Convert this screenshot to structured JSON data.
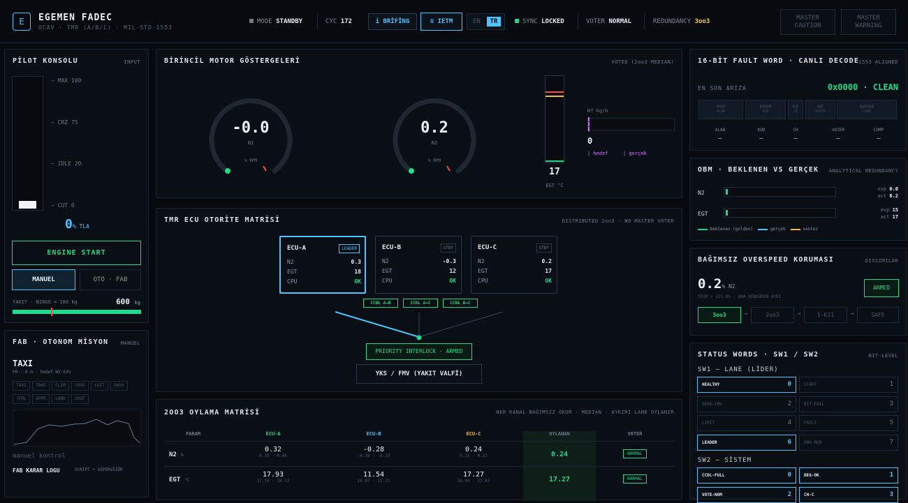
{
  "header": {
    "logo": "E",
    "title": "EGEMEN FADEC",
    "subtitle": "UCAV · TMR (A/B/C) · MIL-STD-1553",
    "mode_label": "MODE",
    "mode_value": "STANDBY",
    "cyc_label": "CYC",
    "cyc_value": "172",
    "briefing": "i BRİFİNG",
    "ietm": "≡ IETM",
    "lang_en": "EN",
    "lang_tr": "TR",
    "sync_label": "SYNC",
    "sync_value": "LOCKED",
    "voter_label": "VOTER",
    "voter_value": "NORMAL",
    "redundancy_label": "REDUNDANCY",
    "redundancy_value": "3oo3",
    "master_caution": [
      "MASTER",
      "CAUTION"
    ],
    "master_warning": [
      "MASTER",
      "WARNING"
    ]
  },
  "pilot": {
    "title": "PİLOT KONSOLU",
    "tag": "INPUT",
    "ticks": [
      "— MAX 100",
      "— CRZ 75",
      "— IDLE 20",
      "— CUT 0"
    ],
    "tla_value": "0",
    "tla_unit": "% TLA",
    "engine_start": "ENGINE START",
    "manual": "MANUEL",
    "auto": "OTO · FAB",
    "fuel_label": "YAKIT · BINGO = 180 kg",
    "fuel_value": "600",
    "fuel_unit": "kg",
    "fuel_fraction": 0.6
  },
  "fab": {
    "title": "FAB · OTONOM MİSYON",
    "tag": "MANUEL",
    "phase": "TAXI",
    "phase_sub": "P0 · 0 m · hedef N2 63%",
    "phases": [
      "TAXI",
      "TAKE",
      "CLIM",
      "CRUI",
      "LOIT",
      "DASH",
      "RTB",
      "APPR",
      "LAND",
      "SHUT"
    ],
    "manual_ctrl": "manuel kontrol",
    "log_title": "FAB KARAR LOGU",
    "log_tag": "SCRIPT + SÜPERVİZÖR"
  },
  "engine": {
    "title": "BİRİNCİL MOTOR GÖSTERGELERİ",
    "tag": "VOTED (2oo3 MEDIAN)",
    "n1_value": "-0.0",
    "n1_label": "N1",
    "n1_unit": "% RPM",
    "n2_value": "0.2",
    "n2_label": "N2",
    "n2_unit": "% RPM",
    "egt_value": "17",
    "egt_label": "EGT °C",
    "wf_label": "Wf kg/h",
    "wf_value": "0",
    "wf_legend_target": "| hedef",
    "wf_legend_actual": "| gerçek"
  },
  "tmr": {
    "title": "TMR ECU OTORİTE MATRİSİ",
    "tag": "DISTRIBUTED 2oo3 · NO MASTER VOTER",
    "ecus": [
      {
        "name": "ECU-A",
        "tag": "LEADER",
        "n2": "0.3",
        "egt": "18",
        "cpu": "OK"
      },
      {
        "name": "ECU-B",
        "tag": "STBY",
        "n2": "-0.3",
        "egt": "12",
        "cpu": "OK"
      },
      {
        "name": "ECU-C",
        "tag": "STBY",
        "n2": "0.2",
        "egt": "17",
        "cpu": "OK"
      }
    ],
    "row_labels": [
      "N2",
      "EGT",
      "CPU"
    ],
    "ccdl": [
      "CCDL A↔B",
      "CCDL A↔C",
      "CCDL B↔C"
    ],
    "interlock": "PRIORITY INTERLOCK · ARMED",
    "fmv": "YKS / FMV (YAKIT VALFİ)"
  },
  "vote": {
    "title": "2OO3 OYLAMA MATRİSİ",
    "tag": "HER KANAL BAĞIMSIZ OKUR · MEDIAN · AYKIRI LANE OYLANIR",
    "headers": [
      "PARAM",
      "ECU-A",
      "ECU-B",
      "ECU-C",
      "OYLANAN",
      "VOTER"
    ],
    "rows": [
      {
        "param": "N2",
        "unit": "%",
        "a": "0.32",
        "a_r": "0.19 · 0.46",
        "b": "-0.28",
        "b_r": "-0.36 · -0.19",
        "c": "0.24",
        "c_r": "0.15 · 0.33",
        "voted": "0.24",
        "voter": "NORMAL"
      },
      {
        "param": "EGT",
        "unit": "°C",
        "a": "17.93",
        "a_r": "17.74 · 18.12",
        "b": "11.54",
        "b_r": "10.87 · 12.21",
        "c": "17.27",
        "c_r": "16.90 · 17.63",
        "voted": "17.27",
        "voter": "NORMAL"
      }
    ]
  },
  "fault": {
    "title": "16-BİT FAULT WORD · CANLI DECODE",
    "tag": "1553 ALIGNED",
    "last_label": "EN SON ARIZA",
    "last_value": "0x0000 · CLEAN",
    "cells": [
      {
        "v": "000",
        "l": "ALAN"
      },
      {
        "v": "0000",
        "l": "KOD"
      },
      {
        "v": "00",
        "l": "CH"
      },
      {
        "v": "00",
        "l": "VOTER"
      },
      {
        "v": "00000",
        "l": "COMP"
      }
    ],
    "labels": [
      "ALAN",
      "KOD",
      "CH",
      "VOTER",
      "COMP"
    ],
    "dash": "–"
  },
  "obm": {
    "title": "OBM · BEKLENEN VS GERÇEK",
    "tag": "ANALYTICAL REDUNDANCY",
    "n2_label": "N2",
    "n2_exp": "0.0",
    "n2_act": "0.2",
    "egt_label": "EGT",
    "egt_exp": "15",
    "egt_act": "17",
    "exp_label": "exp",
    "act_label": "act",
    "legend": [
      "beklenen (golden)",
      "gerçek",
      "sentez"
    ]
  },
  "overspeed": {
    "title": "BAĞIMSIZ OVERSPEED KORUMASI",
    "tag": "DISSIMILAR",
    "value": "0.2",
    "unit": "% N2",
    "trip": "TRIP > 115.0% · ANA DÖNGÜDEN AYRI",
    "armed": "ARMED",
    "chain": [
      "3oo3",
      "2oo3",
      "1-K11",
      "SAFE"
    ]
  },
  "status": {
    "title": "STATUS WORDS · SW1 / SW2",
    "tag": "BIT-LEVEL",
    "sw1_label": "SW1 — LANE (LİDER)",
    "sw2_label": "SW2 — SİSTEM",
    "sw1": [
      {
        "l": "HEALTHY",
        "n": "0",
        "on": true
      },
      {
        "l": "START",
        "n": "1",
        "on": false
      },
      {
        "l": "SENS-INV",
        "n": "2",
        "on": false
      },
      {
        "l": "BIT-FAIL",
        "n": "3",
        "on": false
      },
      {
        "l": "LIMIT",
        "n": "4",
        "on": false
      },
      {
        "l": "FAULT",
        "n": "5",
        "on": false
      },
      {
        "l": "LEADER",
        "n": "6",
        "on": true
      },
      {
        "l": "ENG-RUN",
        "n": "7",
        "on": false
      }
    ],
    "sw2": [
      {
        "l": "CCDL-FULL",
        "n": "0",
        "on": true
      },
      {
        "l": "DEG-OK",
        "n": "1",
        "on": true
      },
      {
        "l": "VOTE-NOM",
        "n": "2",
        "on": true
      },
      {
        "l": "CH-C",
        "n": "3",
        "on": true
      }
    ]
  },
  "colors": {
    "accent": "#4ec3ff",
    "ok": "#22d88a",
    "warn": "#f5b942",
    "alarm": "#ff4a4a",
    "wf": "#d26bff"
  }
}
